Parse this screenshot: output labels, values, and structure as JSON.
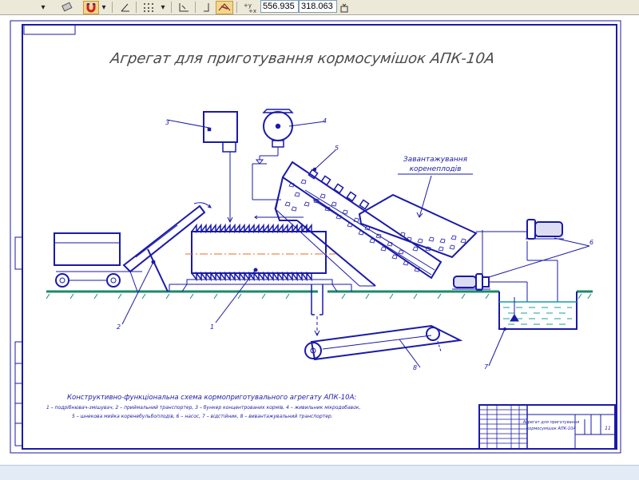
{
  "toolbar": {
    "coord_x": "556.935",
    "coord_y": "318.063",
    "icons": [
      "dropdown-arrow-icon",
      "eraser-icon",
      "magnet-icon",
      "dropdown-arrow-icon",
      "angle-icon",
      "grid-icon",
      "dropdown-arrow-icon",
      "axis-icon",
      "bracket-icon",
      "snap-icon",
      "xy-coordinates-icon",
      "hatch-dropdown-icon"
    ]
  },
  "drawing": {
    "title": "Агрегат для приготування кормосумішок АПК-10А",
    "label_loading_line1": "Завантажування",
    "label_loading_line2": "коренеплодів",
    "callouts": [
      "1",
      "2",
      "3",
      "4",
      "5",
      "6",
      "7",
      "8"
    ],
    "caption_title": "Конструктивно-функціональна схема кормоприготувального агрегату АПК-10А:",
    "caption_line1": "1 – подрібнювач-змішувач, 2 – приймальний транспортер, 3 – бункер концентрованих кормів, 4 – живильник мікродобавок,",
    "caption_line2": "5 – шнекова мийка коренебульбоплодів, 6 – насос, 7 – відстійник, 8 – вивантажувальний транспортер.",
    "title_block_name_line1": "Агрегат для приготування",
    "title_block_name_line2": "кормосумішок АПК-10А",
    "title_block_sheet": "11",
    "colors": {
      "line": "#1a1aa8",
      "water": "#14a0a0",
      "ground": "#1b8a6a",
      "axis": "#e07020",
      "title_text": "#4a4a4a"
    }
  }
}
